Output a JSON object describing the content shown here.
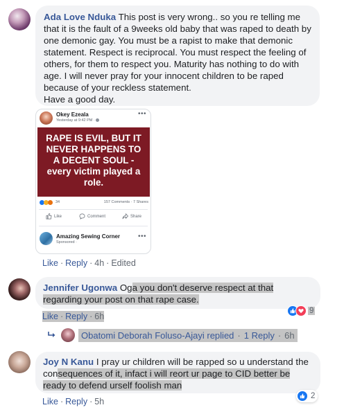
{
  "comments": [
    {
      "author": "Ada Love Nduka",
      "text": "This post is very wrong.. so you re telling me that it is the fault of a 9weeks old baby that was raped to death by one demonic gay. You must be a rapist to make that demonic statement. Respect is reciprocal. You must respect the feeling of others, for them to respect you. Maturity has nothing to do with age. I will never pray for your innocent children to be raped because of your reckless statement.",
      "text2": "Have a good day.",
      "like_label": "Like",
      "reply_label": "Reply",
      "time": "4h",
      "edited": "Edited"
    },
    {
      "author": "Jennifer Ugonwa",
      "text_part1": "Og",
      "text_part2": "a you don't deserve respect at that regarding your post on that rape case.",
      "like_label": "Like",
      "reply_label": "Reply",
      "time": "6h",
      "reaction_count": "9",
      "reply_thread": {
        "name": "Obatomi Deborah Foluso-Ajayi",
        "replied": "replied",
        "count": "1 Reply",
        "time": "6h"
      }
    },
    {
      "author": "Joy N Kanu",
      "text_part1": "I pray ur children will be rapped so u understand the con",
      "text_part2": "sequences of it, infact i will reort ur page to CID better be ready to defend urself foolish man",
      "like_label": "Like",
      "reply_label": "Reply",
      "time": "5h",
      "reaction_count": "2"
    }
  ],
  "embedded_post": {
    "page_name": "Okey Ezeala",
    "timestamp": "Yesterday at 9:42 PM · ",
    "banner_text": "RAPE IS EVIL, BUT IT NEVER HAPPENS TO A DECENT SOUL - every victim played a role.",
    "reaction_count": "34",
    "stats": "157 Comments · 7 Shares",
    "like": "Like",
    "comment": "Comment",
    "share": "Share",
    "next_page_name": "Amazing Sewing Corner",
    "next_page_sub": "Sponsored · "
  },
  "colors": {
    "link": "#385898",
    "bubble": "#f2f3f5",
    "banner": "#7d1a24",
    "like_blue": "#1877f2",
    "love_red": "#f33e58",
    "highlight": "#c4c4c4"
  }
}
